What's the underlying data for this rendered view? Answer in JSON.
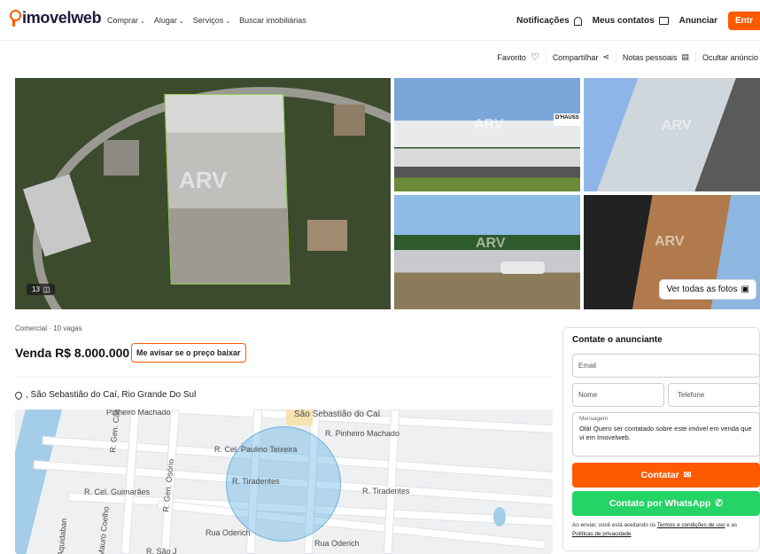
{
  "header": {
    "logo": "imovelweb",
    "nav": [
      "Comprar",
      "Alugar",
      "Serviços",
      "Buscar imobiliárias"
    ],
    "notifications": "Notificações",
    "contacts": "Meus contatos",
    "announce": "Anunciar",
    "login": "Entr"
  },
  "actions": {
    "favorite": "Favorito",
    "share": "Compartilhar",
    "notes": "Notas pessoais",
    "hide": "Ocultar anúncio"
  },
  "gallery": {
    "count": "13",
    "watermark": "ARV",
    "see_all": "Ver todas as fotos",
    "sign": "D'HAUSS"
  },
  "listing": {
    "subtitle": "Comercial · 10 vagas",
    "price": "Venda R$ 8.000.000",
    "notify_button": "Me avisar se o preço baixar",
    "location": ", São Sebastião do Caí, Rio Grande Do Sul"
  },
  "map": {
    "labels": [
      "Pinheiro Machado",
      "São Sebastião do Caí",
      "R. Pinheiro Machado",
      "R. Cel. Paulino Teixeira",
      "R. Tiradentes",
      "R. Tiradentes",
      "R. Cel. Guimarães",
      "R. Gen. Câmara",
      "R. Gen. Osório",
      "Rua Oderich",
      "Rua Oderich",
      "Aquidaban",
      "Mauro Coelho",
      "R. São J"
    ]
  },
  "contact": {
    "title": "Contate o anunciante",
    "email_placeholder": "Email",
    "name_placeholder": "Nome",
    "phone_placeholder": "Telefone",
    "message_label": "Mensagem",
    "message_text": "Olá! Quero ser contatado sobre este imóvel em venda que vi em Imovelweb.",
    "contact_button": "Contatar",
    "whatsapp_button": "Contato por WhatsApp",
    "legal_prefix": "Ao enviar, você está aceitando os ",
    "terms": "Termos e condições de uso",
    "and": " e as ",
    "privacy": "Políticas de privacidade"
  }
}
